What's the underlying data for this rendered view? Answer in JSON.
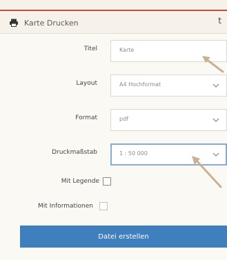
{
  "dialog": {
    "title": "Karte Drucken",
    "icon": "printer-icon",
    "close_glyph": "t"
  },
  "fields": {
    "titel": {
      "label": "Titel",
      "value": "Karte"
    },
    "layout": {
      "label": "Layout",
      "value": "A4 Hochformat"
    },
    "format": {
      "label": "Format",
      "value": "pdf"
    },
    "massstab": {
      "label": "Druckmaßstab",
      "value": "1 : 50 000"
    }
  },
  "checkboxes": {
    "legend": {
      "label": "Mit Legende",
      "checked": false
    },
    "info": {
      "label": "Mit Informationen",
      "checked": false
    }
  },
  "button": {
    "label": "Datei erstellen"
  },
  "colors": {
    "accent": "#3f7fbd",
    "top_border": "#c94b3c",
    "annotation_arrow": "#c7b294"
  }
}
